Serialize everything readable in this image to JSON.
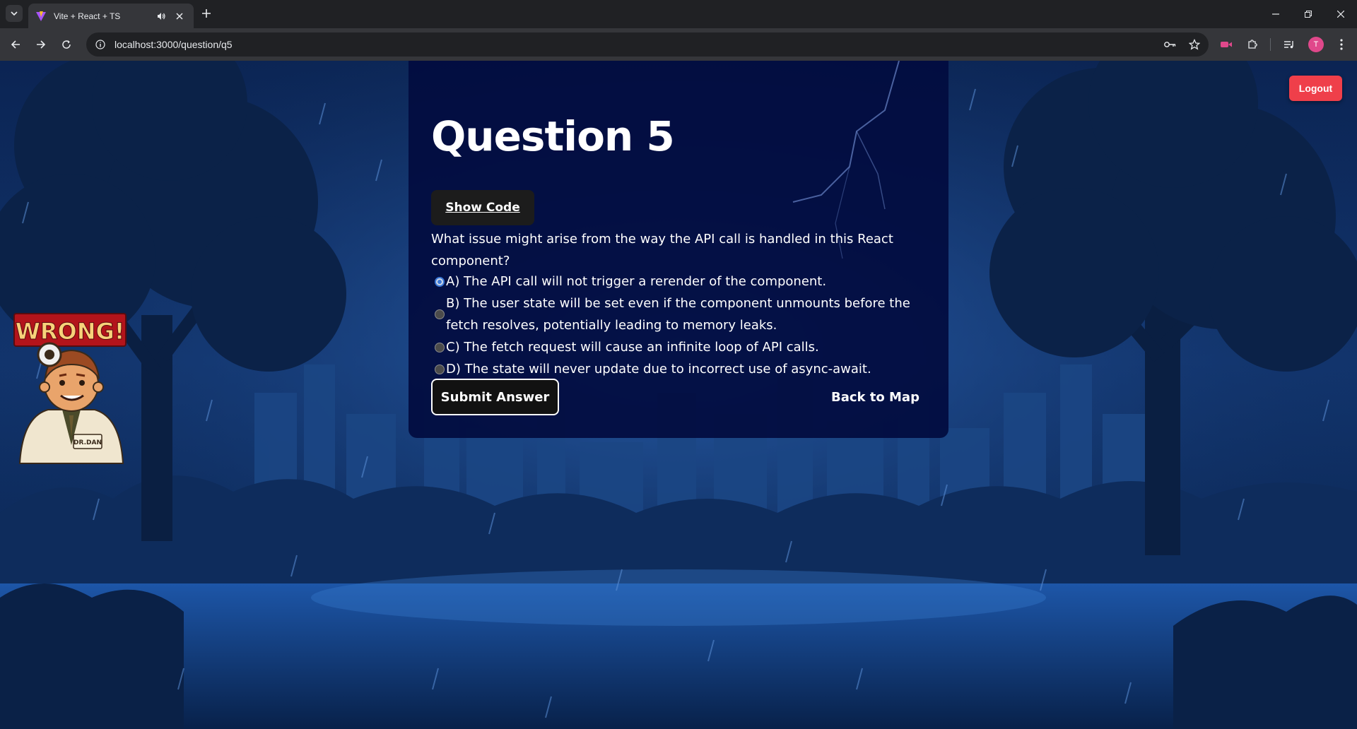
{
  "browser": {
    "tab_title": "Vite + React + TS",
    "url": "localhost:3000/question/q5",
    "profile_initial": "T"
  },
  "page": {
    "logout_label": "Logout",
    "wrong_sign": "WRONG!",
    "badge_text": "DR.DAN",
    "question_title": "Question 5",
    "show_code_label": "Show Code",
    "question_text": "What issue might arise from the way the API call is handled in this React component?",
    "options": [
      {
        "label": "A) The API call will not trigger a rerender of the component.",
        "selected": true
      },
      {
        "label": "B) The user state will be set even if the component unmounts before the fetch resolves, potentially leading to memory leaks.",
        "selected": false
      },
      {
        "label": "C) The fetch request will cause an infinite loop of API calls.",
        "selected": false
      },
      {
        "label": "D) The state will never update due to incorrect use of async-await.",
        "selected": false
      }
    ],
    "submit_label": "Submit Answer",
    "back_label": "Back to Map"
  },
  "colors": {
    "card_bg": "#020c40",
    "logout_bg": "#ef3f4a",
    "wrong_sign_bg": "#b3141b",
    "sky": "#12356e"
  }
}
